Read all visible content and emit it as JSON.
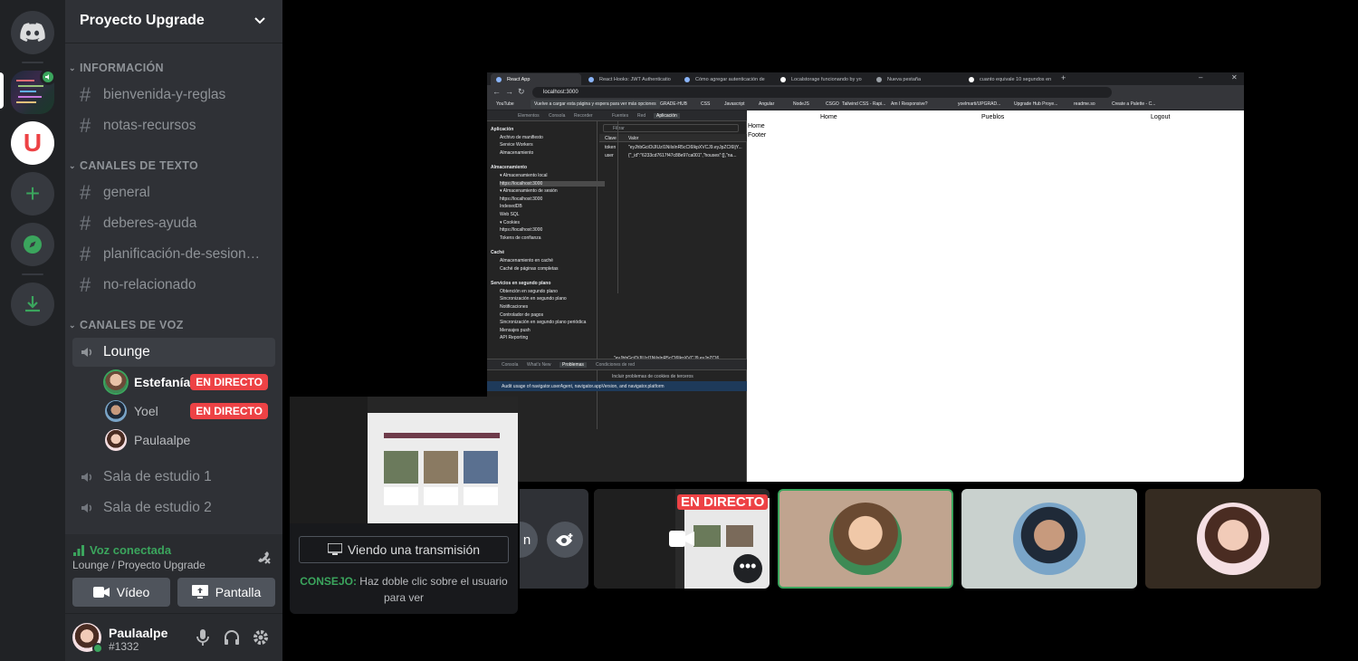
{
  "guild": {
    "name": "Proyecto Upgrade"
  },
  "colors": {
    "rail": "#202225",
    "sidebar": "#2f3136",
    "accent_green": "#3ba55d",
    "live_red": "#ed4245",
    "upgrade_red": "#ed4245"
  },
  "rail": {
    "upgrade_letter": "U"
  },
  "categories": {
    "info": "INFORMACIÓN",
    "text": "CANALES DE TEXTO",
    "voice": "CANALES DE VOZ"
  },
  "info_channels": [
    "bienvenida-y-reglas",
    "notas-recursos"
  ],
  "text_channels": [
    "general",
    "deberes-ayuda",
    "planificación-de-sesion…",
    "no-relacionado"
  ],
  "voice_channels": {
    "lounge": "Lounge",
    "study1": "Sala de estudio 1",
    "study2": "Sala de estudio 2"
  },
  "voice_users": [
    {
      "name": "Estefanía",
      "live": "EN DIRECTO",
      "speaking": true
    },
    {
      "name": "Yoel",
      "live": "EN DIRECTO",
      "speaking": false
    },
    {
      "name": "Paulaalpe",
      "live": "",
      "speaking": false
    }
  ],
  "voice_panel": {
    "status": "Voz conectada",
    "location": "Lounge / Proyecto Upgrade",
    "video_label": "Vídeo",
    "screen_label": "Pantalla"
  },
  "user_panel": {
    "name": "Paulaalpe",
    "tag": "#1332"
  },
  "share": {
    "tabs": [
      "React App",
      "React Hooks: JWT Authenticatio",
      "Cómo agregar autenticación de",
      "Localstorage funcionando by yo",
      "Nueva pestaña",
      "cuanto equivale 10 segundos en"
    ],
    "url": "localhost:3000",
    "tooltip": "Vuelve a cargar esta página y espera para ver más opciones",
    "bookmarks": [
      "YouTube",
      "UPGRADE-HUB",
      "CSS",
      "Javascript",
      "Angular",
      "NodeJS",
      "CSGO",
      "Tailwind CSS - Rapi...",
      "Am I Responsive?",
      "yoelmarti/UPGRAD...",
      "Upgrade Hub Proye...",
      "readme.so",
      "Create a Palette - C..."
    ],
    "devtools_tabs": [
      "Elementos",
      "Consola",
      "Recorder",
      "Fuentes",
      "Red",
      "Aplicación"
    ],
    "devtools_nav": [
      {
        "t": "Aplicación",
        "h": true
      },
      {
        "t": "Archivo de manifiesto"
      },
      {
        "t": "Service Workers"
      },
      {
        "t": "Almacenamiento"
      },
      {
        "t": "Almacenamiento",
        "h": true
      },
      {
        "t": "▾ Almacenamiento local"
      },
      {
        "t": "https://localhost:3000",
        "sel": true
      },
      {
        "t": "▾ Almacenamiento de sesión"
      },
      {
        "t": "https://localhost:3000"
      },
      {
        "t": "IndexedDB"
      },
      {
        "t": "Web SQL"
      },
      {
        "t": "▾ Cookies"
      },
      {
        "t": "https://localhost:3000"
      },
      {
        "t": "Tokens de confianza"
      },
      {
        "t": "Caché",
        "h": true
      },
      {
        "t": "Almacenamiento en caché"
      },
      {
        "t": "Caché de páginas completas"
      },
      {
        "t": "Servicios en segundo plano",
        "h": true
      },
      {
        "t": "Obtención en segundo plano"
      },
      {
        "t": "Sincronización en segundo plano"
      },
      {
        "t": "Notificaciones"
      },
      {
        "t": "Controlador de pagos"
      },
      {
        "t": "Sincronización en segundo plano periódica"
      },
      {
        "t": "Mensajes push"
      },
      {
        "t": "API Reporting"
      }
    ],
    "filter_placeholder": "Filtrar",
    "table_headers": [
      "Clave",
      "Valor"
    ],
    "table_rows": [
      {
        "key": "token",
        "value": "\"eyJhbGciOiJIUzI1NiIsInR5cCI6IkpXVCJ9.eyJpZCI6IjY..."
      },
      {
        "key": "user",
        "value": "{\"_id\":\"6233cd7617f47c88e97ca001\",\"houses\":[],\"na..."
      }
    ],
    "preview_line": "\"eyJhbGciOiJIUzI1NiIsInR5cCI6IkpXVCJ9.eyJpZCI6",
    "console_tabs": [
      "Consola",
      "What's New",
      "Problemas",
      "Condiciones de red"
    ],
    "console_option": "Incluir problemas de cookies de terceros",
    "console_issue": "Audit usage of navigator.userAgent, navigator.appVersion, and navigator.platform",
    "page_links": [
      "Home",
      "Pueblos",
      "Logout"
    ],
    "page_lines": [
      "Home",
      "Footer"
    ]
  },
  "tiles": {
    "live_badge": "EN DIRECTO",
    "partial_label": "n"
  },
  "popout": {
    "button": "Viendo una transmisión",
    "tip_label": "CONSEJO:",
    "tip_text": "Haz doble clic sobre el usuario para ver"
  }
}
